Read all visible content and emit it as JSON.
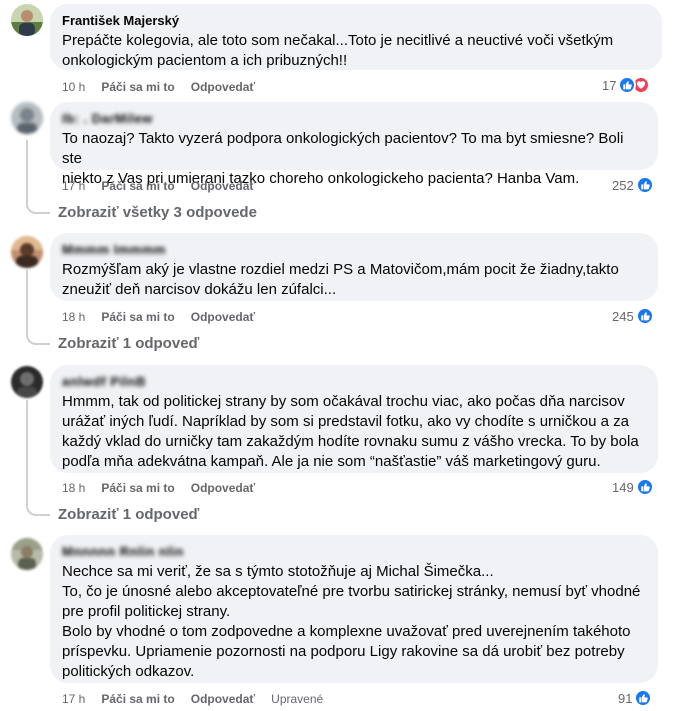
{
  "comments": [
    {
      "author": "František Majerský",
      "lines": [
        "Prepáčte kolegovia, ale toto som nečakal...Toto je necitlivé a neuctivé voči všetkým",
        "onkologickým pacientom a ich pribuzných!!"
      ],
      "time": "10 h",
      "like_label": "Páči sa mi to",
      "reply_label": "Odpovedať",
      "reactions": "17",
      "avatar_color": "#7d9a5a"
    },
    {
      "author": "Ib: . DarMilew",
      "lines": [
        "To naozaj? Takto vyzerá podpora onkologických pacientov? To ma byt smiesne? Boli ste",
        "niekto z Vas pri umierani tazko choreho onkologickeho pacienta? Hanba Vam."
      ],
      "time": "17 h",
      "like_label": "Páči sa mi to",
      "reply_label": "Odpovedať",
      "reactions": "252",
      "replies": "Zobraziť všetky 3 odpovede",
      "avatar_color": "#8a9298"
    },
    {
      "author": "Mmmm Immmm",
      "lines": [
        "Rozmýšľam aký je vlastne rozdiel medzi PS a Matovičom,mám pocit že žiadny,takto",
        "zneužiť deň narcisov dokážu len zúfalci..."
      ],
      "time": "18 h",
      "like_label": "Páči sa mi to",
      "reply_label": "Odpovedať",
      "reactions": "245",
      "replies": "Zobraziť 1 odpoveď",
      "avatar_color": "#6b4a3a"
    },
    {
      "author": "anlwdf PilnB",
      "lines": [
        "Hmmm, tak od politickej strany by som očakával trochu viac, ako počas dňa narcisov",
        "urážať iných ľudí. Napríklad by som si predstavil fotku, ako vy chodíte s urničkou a za",
        "každý vklad do urničky tam zakaždým hodíte rovnaku sumu z vášho vrecka. To by bola",
        "podľa mňa adekvátna kampaň. Ale ja nie som “našťastie” váš marketingový guru."
      ],
      "time": "18 h",
      "like_label": "Páči sa mi to",
      "reply_label": "Odpovedať",
      "reactions": "149",
      "replies": "Zobraziť 1 odpoveď",
      "avatar_color": "#3a3a3a"
    },
    {
      "author": "Mnnnnn Rnlin nlin",
      "lines": [
        "Nechce sa mi veriť, že sa s týmto stotožňuje aj Michal Šimečka...",
        "To, čo je únosné alebo akceptovateľné pre tvorbu satirickej stránky, nemusí byť vhodné",
        "pre profil politickej strany.",
        "Bolo by vhodné o tom zodpovedne a komplexne uvažovať pred uverejnením takéhoto",
        "príspevku. Upriamenie pozornosti na podporu Ligy rakovine sa dá urobiť bez potreby",
        "politických odkazov."
      ],
      "time": "17 h",
      "like_label": "Páči sa mi to",
      "reply_label": "Odpovedať",
      "edited_label": "Upravené",
      "reactions": "91",
      "avatar_color": "#8a8f7a"
    }
  ],
  "icons": {
    "like": "like-icon",
    "heart": "heart-icon"
  },
  "colors": {
    "like": "#1877f2",
    "heart": "#f33e58",
    "bubble": "#f0f2f5",
    "secondary_text": "#65676b"
  }
}
